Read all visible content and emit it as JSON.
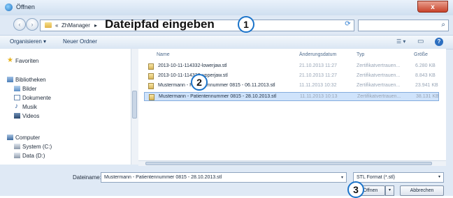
{
  "window": {
    "title": "Öffnen",
    "close_symbol": "x"
  },
  "nav_buttons": {
    "back": "‹",
    "forward": "›"
  },
  "address": {
    "prefix": "«",
    "folder": "ZhManager",
    "separator": "▸",
    "annotation": "Dateipfad eingeben",
    "dropdown": "▾",
    "refresh": "⟳"
  },
  "search": {
    "icon": "⌕"
  },
  "toolbar": {
    "organize": "Organisieren ▾",
    "new_folder": "Neuer Ordner",
    "view_icon": "☰ ▾",
    "preview_icon": "▭",
    "help": "?"
  },
  "sidebar": {
    "favorites": "Favoriten",
    "libraries": "Bibliotheken",
    "lib_items": [
      "Bilder",
      "Dokumente",
      "Musik",
      "Videos"
    ],
    "computer": "Computer",
    "computer_items": [
      "System (C:)",
      "Data (D:)"
    ]
  },
  "columns": {
    "name": "Name",
    "date": "Änderungsdatum",
    "type": "Typ",
    "size": "Größe"
  },
  "files": [
    {
      "name": "2013-10-11-114332-lowerjaw.stl",
      "date": "21.10.2013 11:27",
      "type": "Zertifikatvertrauen...",
      "size": "6.280 KB"
    },
    {
      "name": "2013-10-11-114332-upperjaw.stl",
      "date": "21.10.2013 11:27",
      "type": "Zertifikatvertrauen...",
      "size": "8.843 KB"
    },
    {
      "name": "Mustermann - Patientennummer 0815 - 06.11.2013.stl",
      "date": "11.11.2013 10:32",
      "type": "Zertifikatvertrauen...",
      "size": "23.941 KB"
    },
    {
      "name": "Mustermann - Patientennummer 0815 - 28.10.2013.stl",
      "date": "11.11.2013 10:13",
      "type": "Zertifikatvertrauen...",
      "size": "38.131 KB"
    }
  ],
  "bottom": {
    "filename_label": "Dateiname:",
    "filename_value": "Mustermann - Patientennummer 0815 - 28.10.2013.stl",
    "dropdown": "▾",
    "filter": "STL Format (*.stl)",
    "open": "Öffnen",
    "cancel": "Abbrechen"
  },
  "markers": [
    "1",
    "2",
    "3"
  ]
}
